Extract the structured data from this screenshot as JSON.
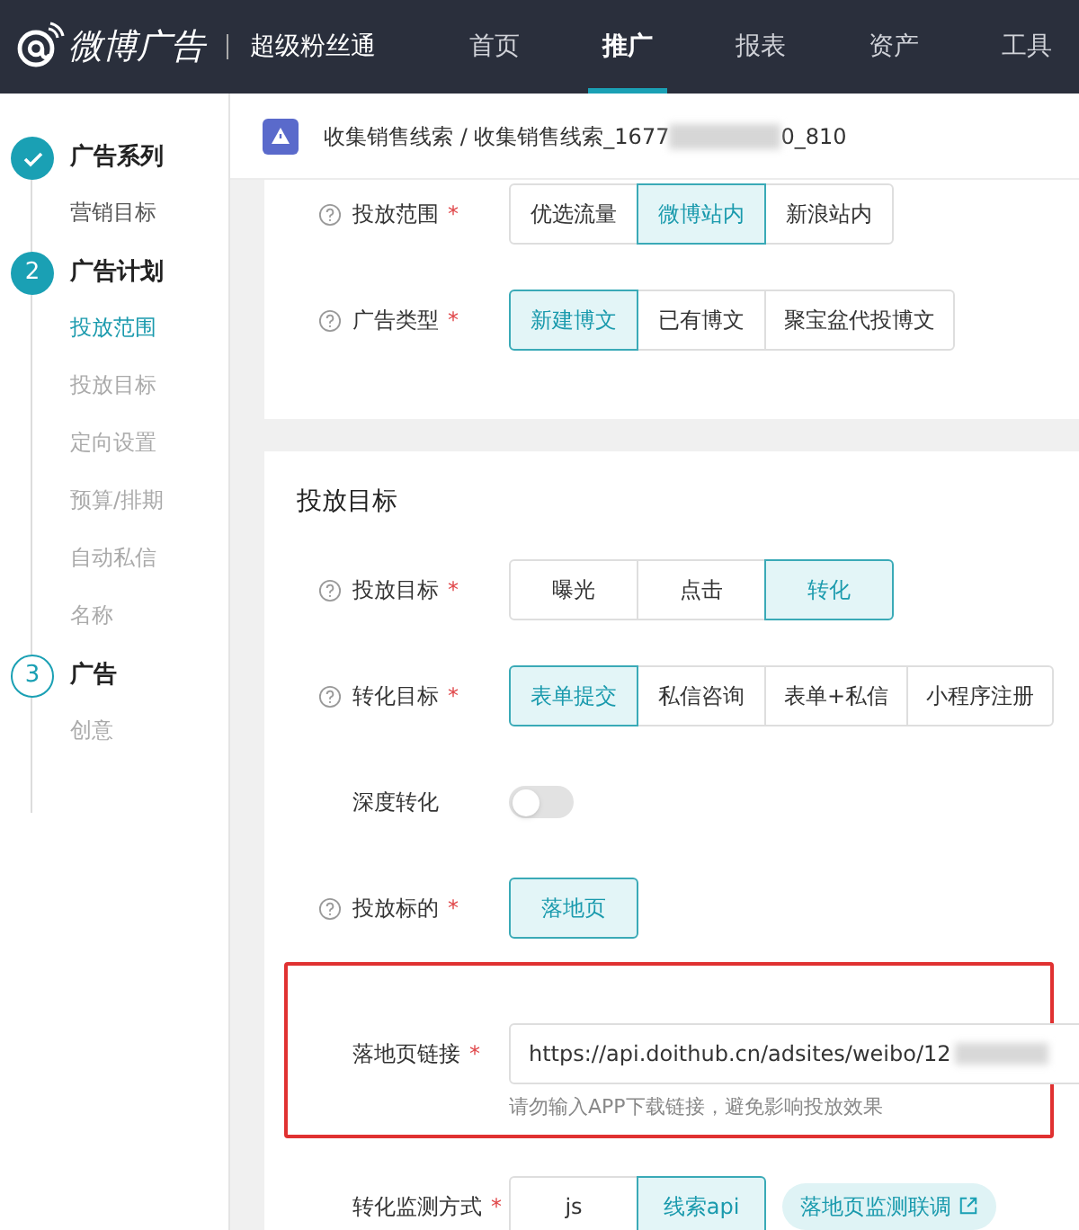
{
  "header": {
    "logo": "微博广告",
    "product": "超级粉丝通",
    "nav": [
      {
        "label": "首页",
        "selected": false
      },
      {
        "label": "推广",
        "selected": true
      },
      {
        "label": "报表",
        "selected": false
      },
      {
        "label": "资产",
        "selected": false
      },
      {
        "label": "工具",
        "selected": false
      }
    ]
  },
  "sidebar": {
    "steps": [
      {
        "kind": "done",
        "title": "广告系列",
        "items": [
          {
            "label": "营销目标",
            "selected": false
          }
        ]
      },
      {
        "kind": "active",
        "number": "2",
        "title": "广告计划",
        "items": [
          {
            "label": "投放范围",
            "selected": true
          },
          {
            "label": "投放目标",
            "selected": false
          },
          {
            "label": "定向设置",
            "selected": false
          },
          {
            "label": "预算/排期",
            "selected": false
          },
          {
            "label": "自动私信",
            "selected": false
          },
          {
            "label": "名称",
            "selected": false
          }
        ]
      },
      {
        "kind": "pending",
        "number": "3",
        "title": "广告",
        "items": [
          {
            "label": "创意",
            "selected": false
          }
        ]
      }
    ]
  },
  "breadcrumb": {
    "prefix": "收集销售线索 / 收集销售线索_1677",
    "suffix": "0_810"
  },
  "sections": [
    {
      "fields": [
        {
          "kind": "segmented",
          "label": "投放范围",
          "help": true,
          "required": "*",
          "options": [
            {
              "label": "优选流量",
              "selected": false
            },
            {
              "label": "微博站内",
              "selected": true
            },
            {
              "label": "新浪站内",
              "selected": false
            }
          ]
        },
        {
          "kind": "segmented",
          "label": "广告类型",
          "help": true,
          "required": "*",
          "options": [
            {
              "label": "新建博文",
              "selected": true
            },
            {
              "label": "已有博文",
              "selected": false
            },
            {
              "label": "聚宝盆代投博文",
              "selected": false
            }
          ]
        }
      ]
    },
    {
      "title": "投放目标",
      "fields": [
        {
          "kind": "segmented",
          "label": "投放目标",
          "help": true,
          "required": "*",
          "options": [
            {
              "label": "曝光",
              "selected": false
            },
            {
              "label": "点击",
              "selected": false
            },
            {
              "label": "转化",
              "selected": true
            }
          ]
        },
        {
          "kind": "segmented",
          "label": "转化目标",
          "help": true,
          "required": "*",
          "options": [
            {
              "label": "表单提交",
              "selected": true
            },
            {
              "label": "私信咨询",
              "selected": false
            },
            {
              "label": "表单+私信",
              "selected": false
            },
            {
              "label": "小程序注册",
              "selected": false
            }
          ]
        },
        {
          "kind": "switch",
          "label": "深度转化",
          "help": false,
          "on": false
        },
        {
          "kind": "segmented",
          "label": "投放标的",
          "help": true,
          "required": "*",
          "options": [
            {
              "label": "落地页",
              "selected": true
            }
          ]
        },
        {
          "kind": "input",
          "label": "落地页链接",
          "help": false,
          "required": "*",
          "highlighted": true,
          "value": "https://api.doithub.cn/adsites/weibo/12",
          "hint": "请勿输入APP下载链接，避免影响投放效果"
        },
        {
          "kind": "segmented",
          "label": "转化监测方式",
          "help": false,
          "required": "*",
          "options": [
            {
              "label": "js",
              "selected": false
            },
            {
              "label": "线索api",
              "selected": true
            }
          ],
          "link": "落地页监测联调"
        }
      ]
    }
  ]
}
